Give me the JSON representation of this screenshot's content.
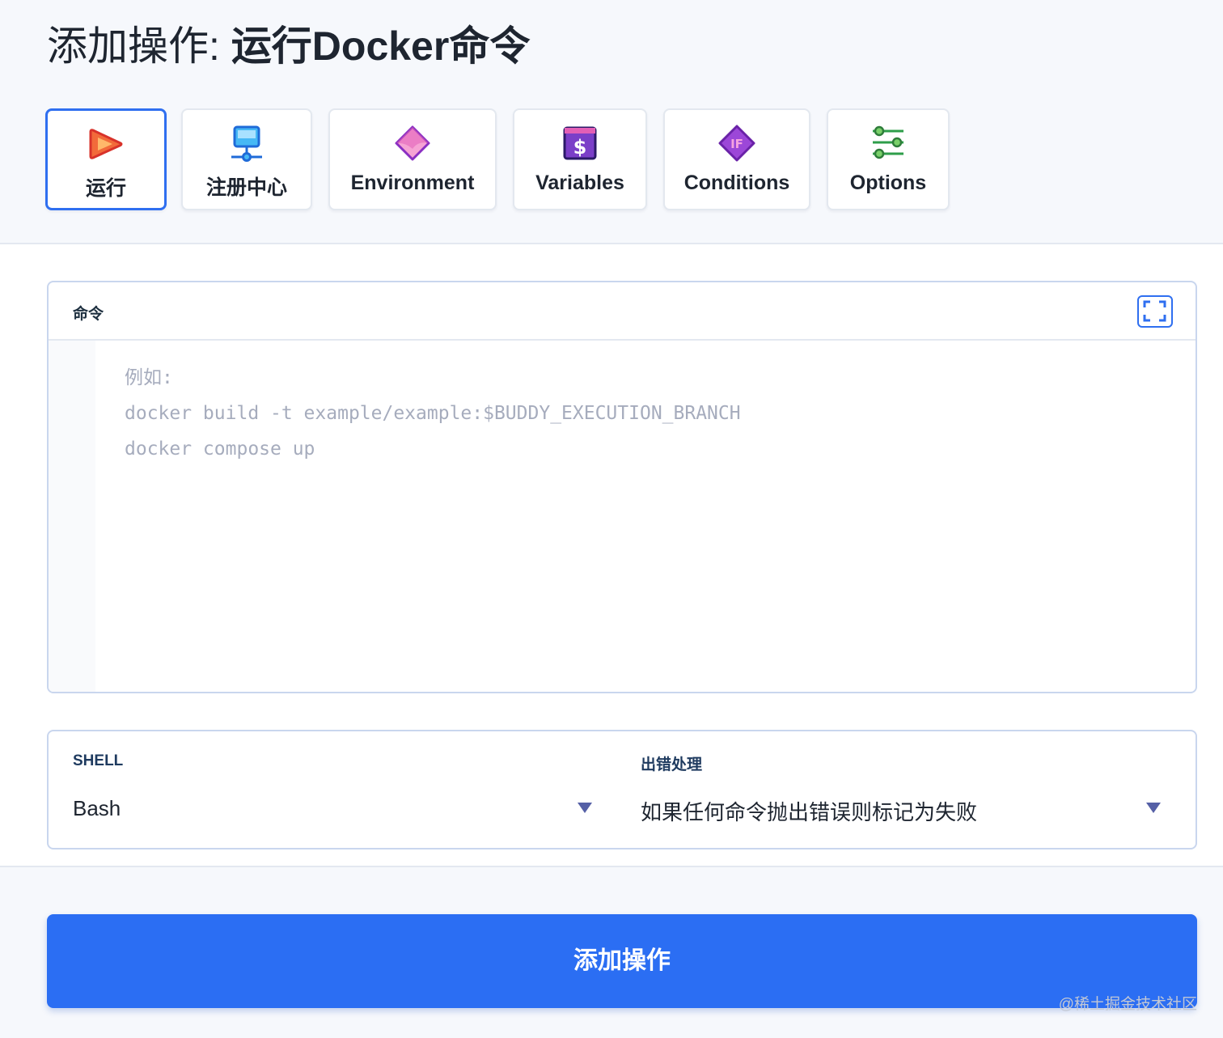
{
  "header": {
    "title_prefix": "添加操作: ",
    "title_name": "运行Docker命令"
  },
  "tabs": [
    {
      "label": "运行",
      "icon": "play-icon",
      "active": true
    },
    {
      "label": "注册中心",
      "icon": "registry-monitor-icon",
      "active": false
    },
    {
      "label": "Environment",
      "icon": "environment-diamond-icon",
      "active": false
    },
    {
      "label": "Variables",
      "icon": "dollar-variable-icon",
      "active": false
    },
    {
      "label": "Conditions",
      "icon": "if-condition-icon",
      "active": false
    },
    {
      "label": "Options",
      "icon": "sliders-options-icon",
      "active": false
    }
  ],
  "command": {
    "label": "命令",
    "placeholder_lines": [
      "例如:",
      "docker build -t example/example:$BUDDY_EXECUTION_BRANCH",
      "docker compose up"
    ],
    "expand_icon": "fullscreen-icon"
  },
  "shell": {
    "label": "SHELL",
    "value": "Bash"
  },
  "error_handling": {
    "label": "出错处理",
    "value": "如果任何命令抛出错误则标记为失败"
  },
  "submit": {
    "label": "添加操作"
  },
  "watermark": "@稀土掘金技术社区",
  "colors": {
    "accent": "#2b6ef3",
    "active_border": "#2f6ff0",
    "placeholder": "#a6acbd"
  }
}
